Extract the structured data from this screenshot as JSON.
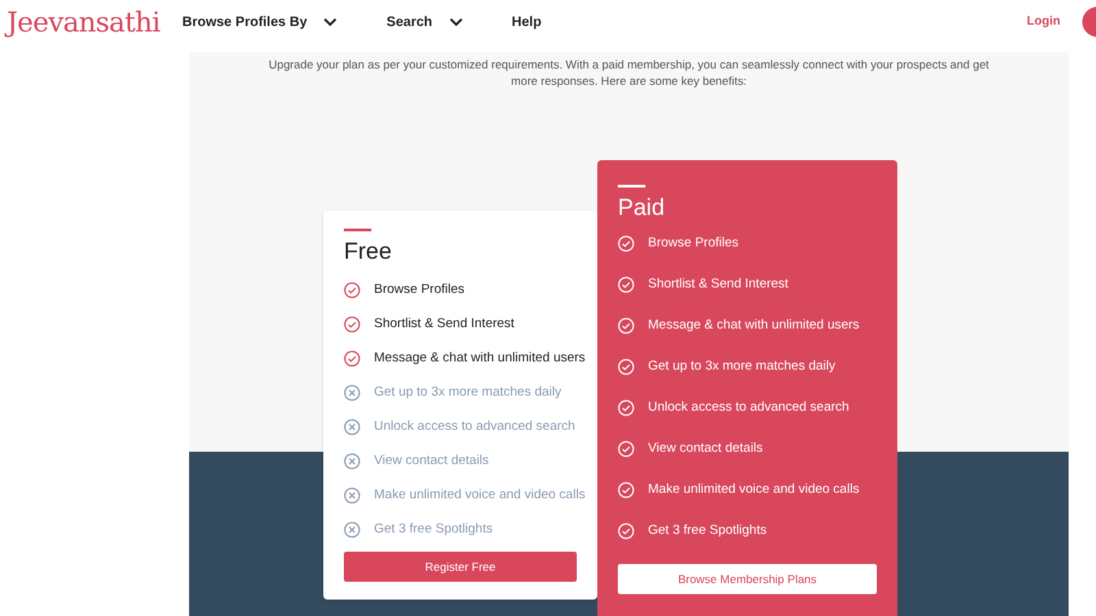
{
  "header": {
    "logo": "Jeevansathi",
    "nav": [
      {
        "label": "Browse Profiles By",
        "dropdown": true
      },
      {
        "label": "Search",
        "dropdown": true
      },
      {
        "label": "Help",
        "dropdown": false
      }
    ],
    "login": "Login"
  },
  "intro": "Upgrade your plan as per your customized requirements. With a paid membership, you can seamlessly connect with your prospects and get more responses. Here are some key benefits:",
  "plans": [
    {
      "name": "Free",
      "highlighted": false,
      "button": "Register Free",
      "features": [
        {
          "text": "Browse Profiles",
          "included": true
        },
        {
          "text": "Shortlist & Send Interest",
          "included": true
        },
        {
          "text": "Message & chat with unlimited users",
          "included": true
        },
        {
          "text": "Get up to 3x more matches daily",
          "included": false
        },
        {
          "text": "Unlock access to advanced search",
          "included": false
        },
        {
          "text": "View contact details",
          "included": false
        },
        {
          "text": "Make unlimited voice and video calls",
          "included": false
        },
        {
          "text": "Get 3 free Spotlights",
          "included": false
        }
      ]
    },
    {
      "name": "Paid",
      "highlighted": true,
      "button": "Browse Membership Plans",
      "features": [
        {
          "text": "Browse Profiles",
          "included": true
        },
        {
          "text": "Shortlist & Send Interest",
          "included": true
        },
        {
          "text": "Message & chat with unlimited users",
          "included": true
        },
        {
          "text": "Get up to 3x more matches daily",
          "included": true
        },
        {
          "text": "Unlock access to advanced search",
          "included": true
        },
        {
          "text": "View contact details",
          "included": true
        },
        {
          "text": "Make unlimited voice and video calls",
          "included": true
        },
        {
          "text": "Get 3 free Spotlights",
          "included": true
        }
      ]
    }
  ]
}
